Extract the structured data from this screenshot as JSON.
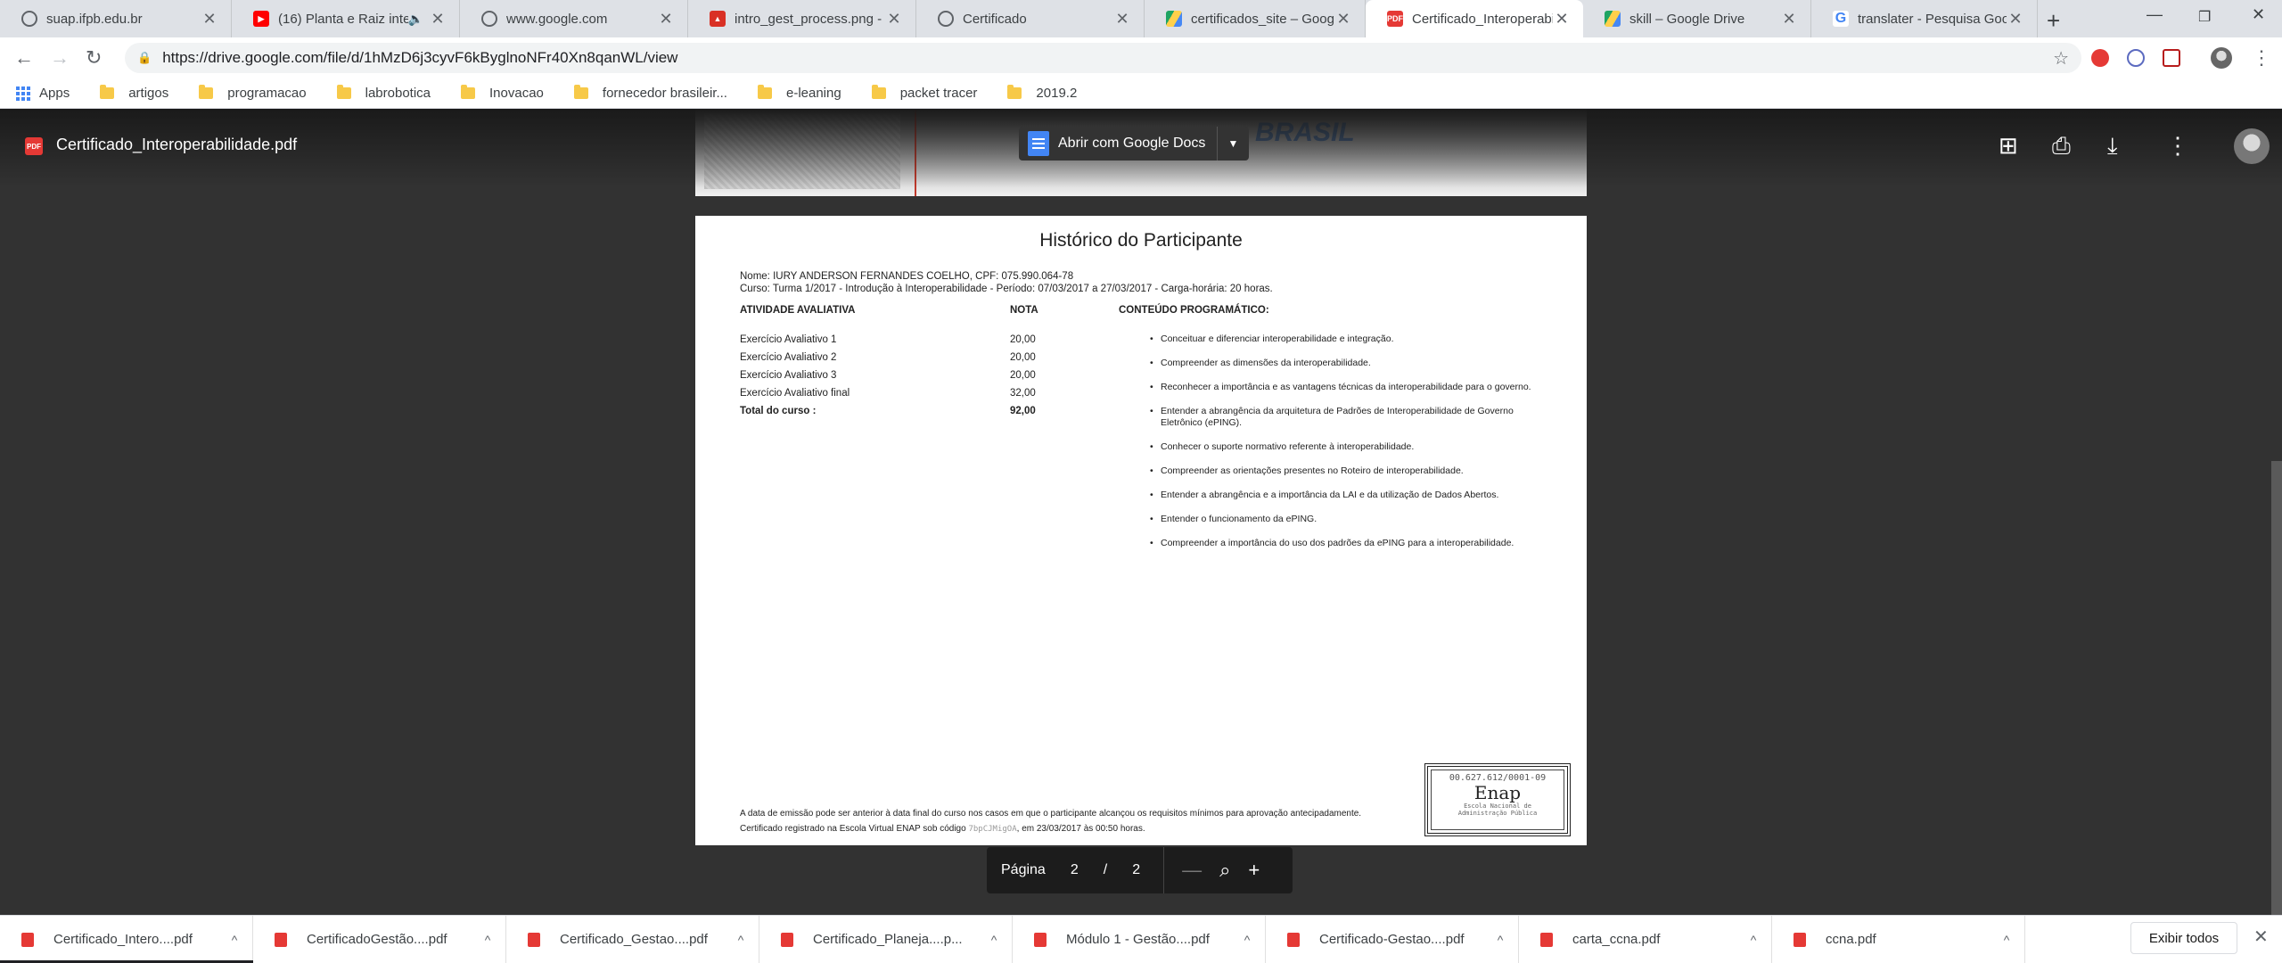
{
  "browser": {
    "tabs": [
      {
        "title": "suap.ifpb.edu.br",
        "favicon": "globe-icon"
      },
      {
        "title": "(16) Planta e Raiz inte",
        "favicon": "youtube-icon",
        "audio": "🔈"
      },
      {
        "title": "www.google.com",
        "favicon": "globe-icon"
      },
      {
        "title": "intro_gest_process.png - G",
        "favicon": "image-icon"
      },
      {
        "title": "Certificado",
        "favicon": "globe-icon"
      },
      {
        "title": "certificados_site – Google",
        "favicon": "drive-icon"
      },
      {
        "title": "Certificado_Interoperabili",
        "favicon": "pdf-icon",
        "active": true
      },
      {
        "title": "skill – Google Drive",
        "favicon": "drive-icon"
      },
      {
        "title": "translater - Pesquisa Goog",
        "favicon": "google-icon"
      }
    ],
    "url": "https://drive.google.com/file/d/1hMzD6j3cyvF6kByglnoNFr40Xn8qanWL/view"
  },
  "bookmarks": {
    "apps": "Apps",
    "items": [
      "artigos",
      "programacao",
      "labrobotica",
      "Inovacao",
      "fornecedor brasileir...",
      "e-leaning",
      "packet tracer",
      "2019.2"
    ]
  },
  "viewer": {
    "file_title": "Certificado_Interoperabilidade.pdf",
    "open_with": "Abrir com Google Docs",
    "page_label": "Página",
    "current_page": "2",
    "page_separator": "/",
    "total_pages": "2"
  },
  "document": {
    "title": "Histórico do Participante",
    "name_line": "Nome: IURY ANDERSON FERNANDES COELHO, CPF: 075.990.064-78",
    "course_line": "Curso: Turma 1/2017 - Introdução à Interoperabilidade - Período: 07/03/2017 a 27/03/2017 - Carga-horária: 20 horas.",
    "col_activity": "ATIVIDADE AVALIATIVA",
    "col_grade": "NOTA",
    "col_content": "CONTEÚDO PROGRAMÁTICO:",
    "rows": [
      {
        "activity": "Exercício Avaliativo 1",
        "grade": "20,00"
      },
      {
        "activity": "Exercício Avaliativo 2",
        "grade": "20,00"
      },
      {
        "activity": "Exercício Avaliativo 3",
        "grade": "20,00"
      },
      {
        "activity": "Exercício Avaliativo final",
        "grade": "32,00"
      }
    ],
    "total_label": "Total do curso :",
    "total_value": "92,00",
    "contents": [
      "Conceituar e diferenciar interoperabilidade e integração.",
      "Compreender as dimensões da interoperabilidade.",
      "Reconhecer a importância e as vantagens técnicas da interoperabilidade para o governo.",
      "Entender a abrangência da arquitetura de Padrões de Interoperabilidade de Governo Eletrônico (ePING).",
      "Conhecer o suporte normativo referente à interoperabilidade.",
      "Compreender as orientações presentes no Roteiro de interoperabilidade.",
      "Entender a abrangência e a importância da LAI e da utilização de Dados Abertos.",
      "Entender o funcionamento da ePING.",
      "Compreender a importância do uso dos padrões da ePING para a interoperabilidade."
    ],
    "footer_1": "A data de emissão pode ser anterior à data final do curso nos casos em que o participante alcançou os requisitos mínimos para aprovação antecipadamente.",
    "footer_2_pre": "Certificado registrado na Escola Virtual ENAP sob código",
    "footer_2_code": "7bpCJMigOA",
    "footer_2_post": ", em 23/03/2017 às 00:50 horas.",
    "stamp_cnpj": "00.627.612/0001-09",
    "stamp_name": "Enap",
    "stamp_sub_1": "Escola Nacional de",
    "stamp_sub_2": "Administração Pública"
  },
  "downloads": {
    "items": [
      "Certificado_Intero....pdf",
      "CertificadoGestão....pdf",
      "Certificado_Gestao....pdf",
      "Certificado_Planeja....p...",
      "Módulo 1 - Gestão....pdf",
      "Certificado-Gestao....pdf",
      "carta_ccna.pdf",
      "ccna.pdf"
    ],
    "show_all": "Exibir todos"
  }
}
